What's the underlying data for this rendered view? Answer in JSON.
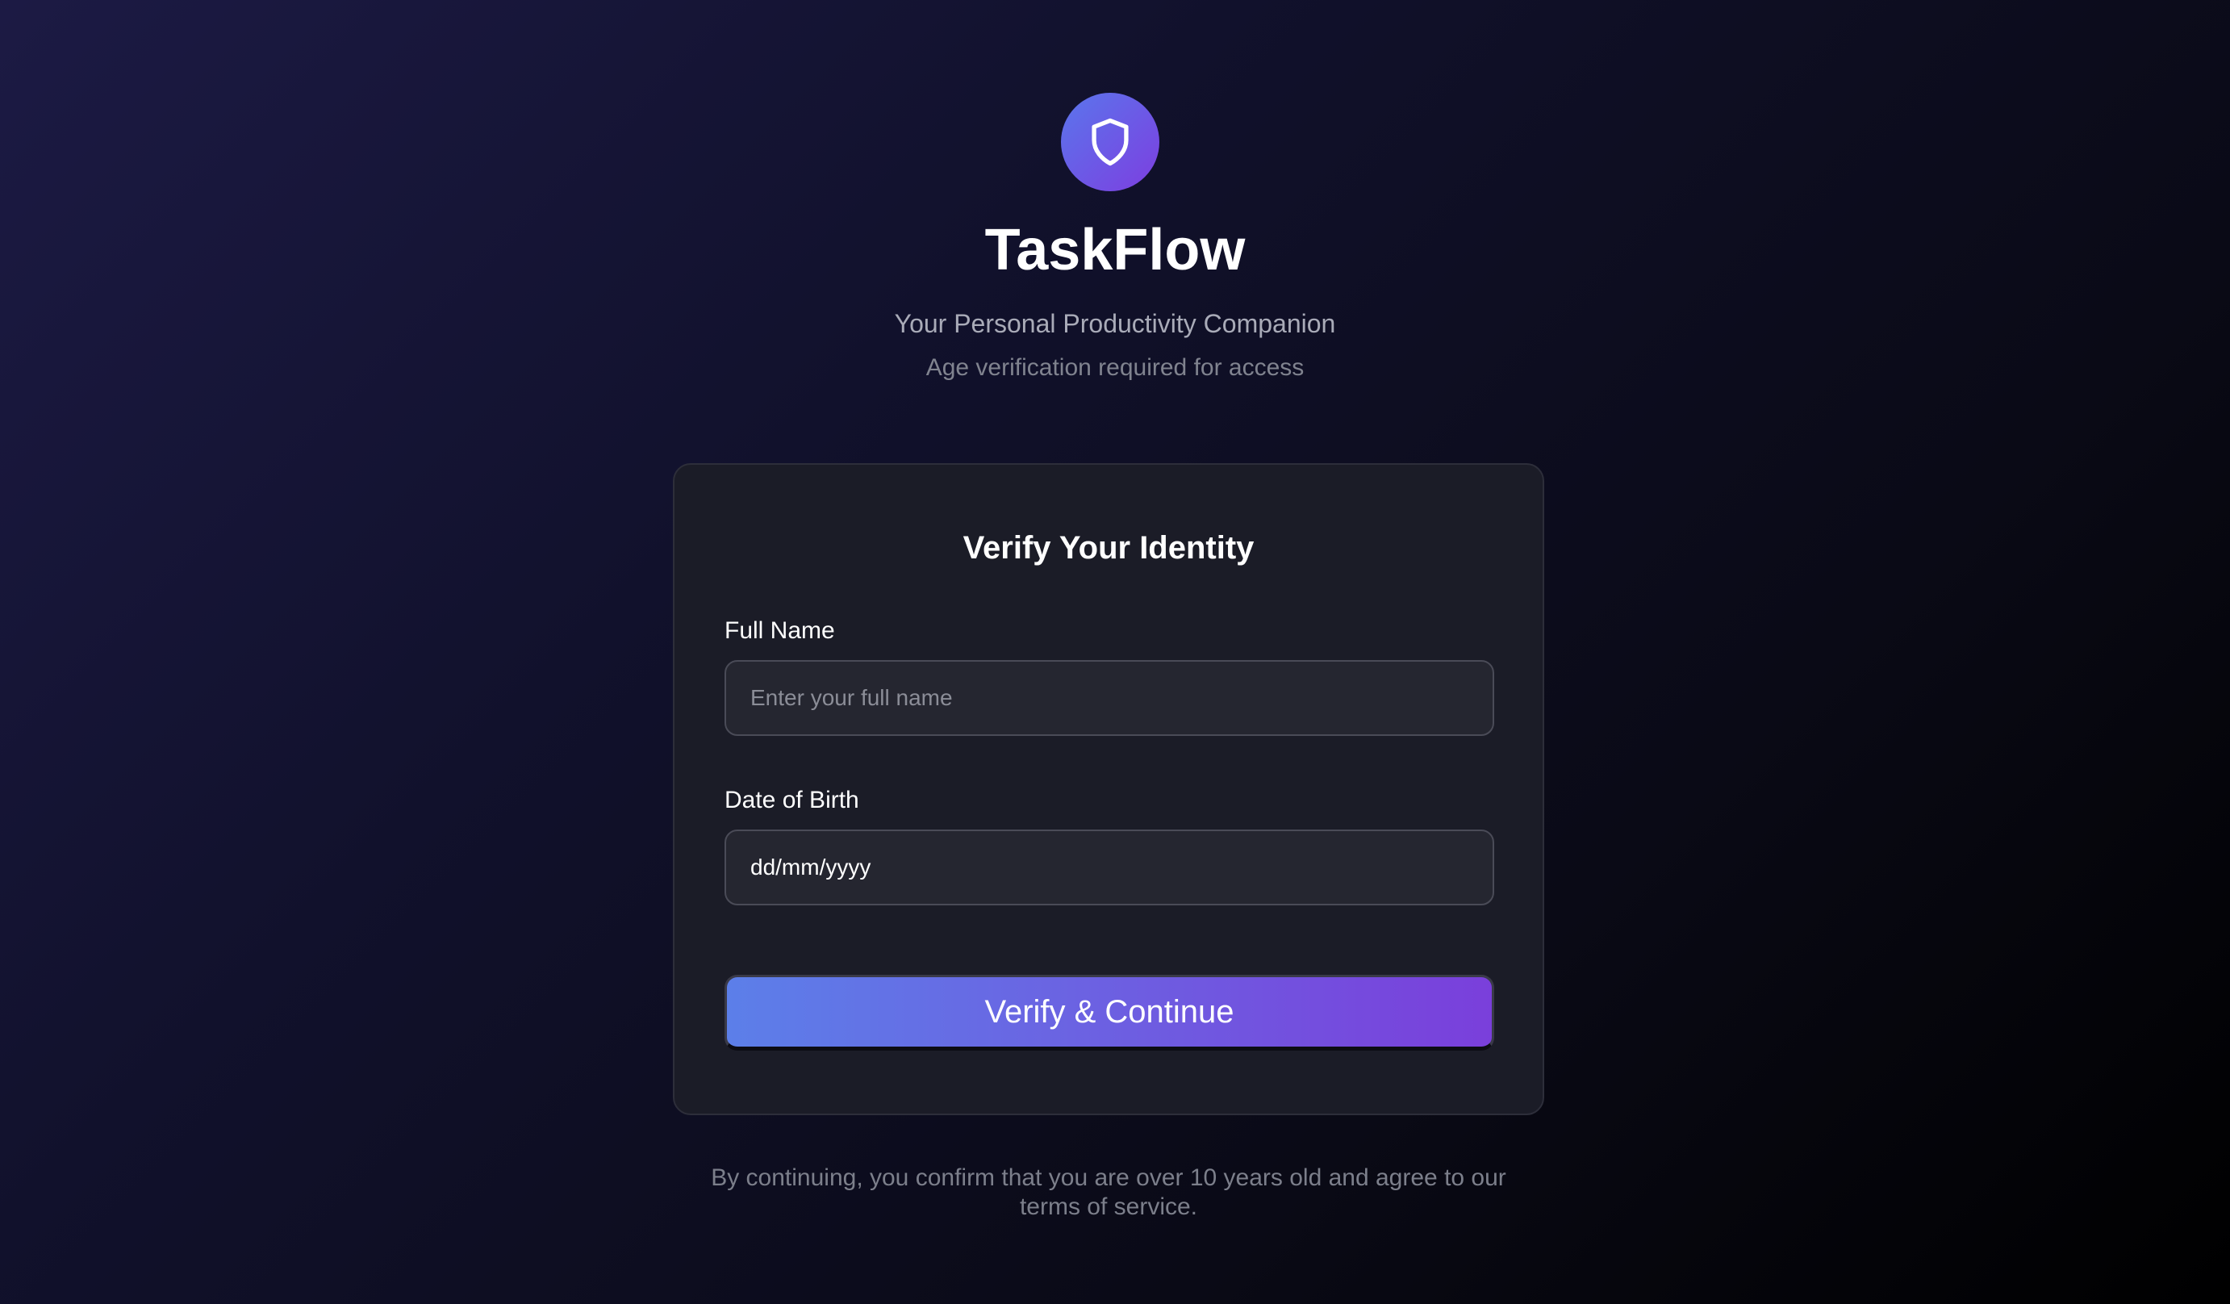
{
  "brand": {
    "logo_icon": "shield-icon",
    "title": "TaskFlow",
    "tagline": "Your Personal Productivity Companion",
    "note": "Age verification required for access"
  },
  "form": {
    "heading": "Verify Your Identity",
    "full_name": {
      "label": "Full Name",
      "placeholder": "Enter your full name",
      "value": ""
    },
    "dob": {
      "label": "Date of Birth",
      "value": "dd/mm/yyyy"
    },
    "submit_label": "Verify & Continue"
  },
  "footer": {
    "disclaimer": "By continuing, you confirm that you are over 10 years old and agree to our terms of service."
  },
  "colors": {
    "accent_start": "#5c7fe9",
    "accent_end": "#7a3fdb",
    "card_background": "#1b1c27",
    "page_background": "#11112c"
  }
}
